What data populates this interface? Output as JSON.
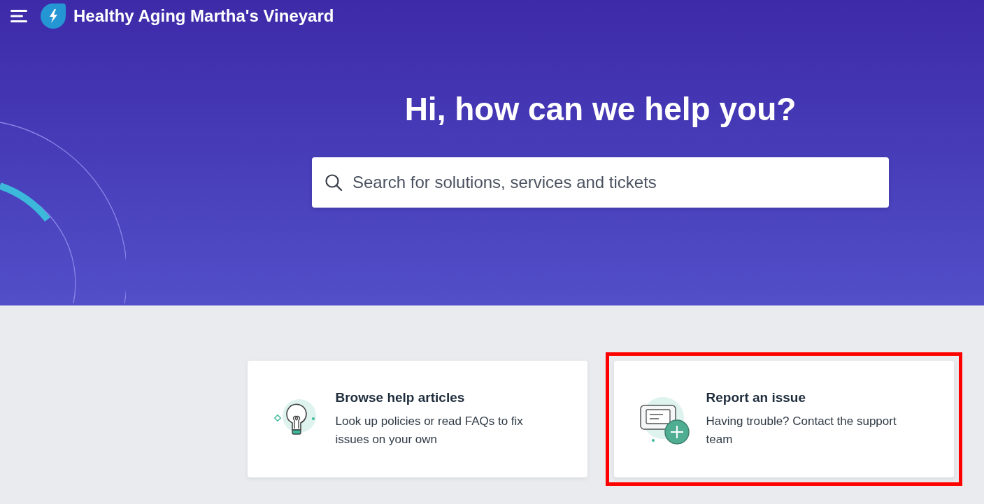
{
  "header": {
    "title": "Healthy Aging Martha's Vineyard"
  },
  "hero": {
    "heading": "Hi, how can we help you?",
    "search": {
      "placeholder": "Search for solutions, services and tickets"
    }
  },
  "cards": [
    {
      "kind": "articles",
      "title": "Browse help articles",
      "description": "Look up policies or read FAQs to fix issues on your own",
      "highlighted": false
    },
    {
      "kind": "ticket",
      "title": "Report an issue",
      "description": "Having trouble? Contact the support team",
      "highlighted": true
    }
  ]
}
